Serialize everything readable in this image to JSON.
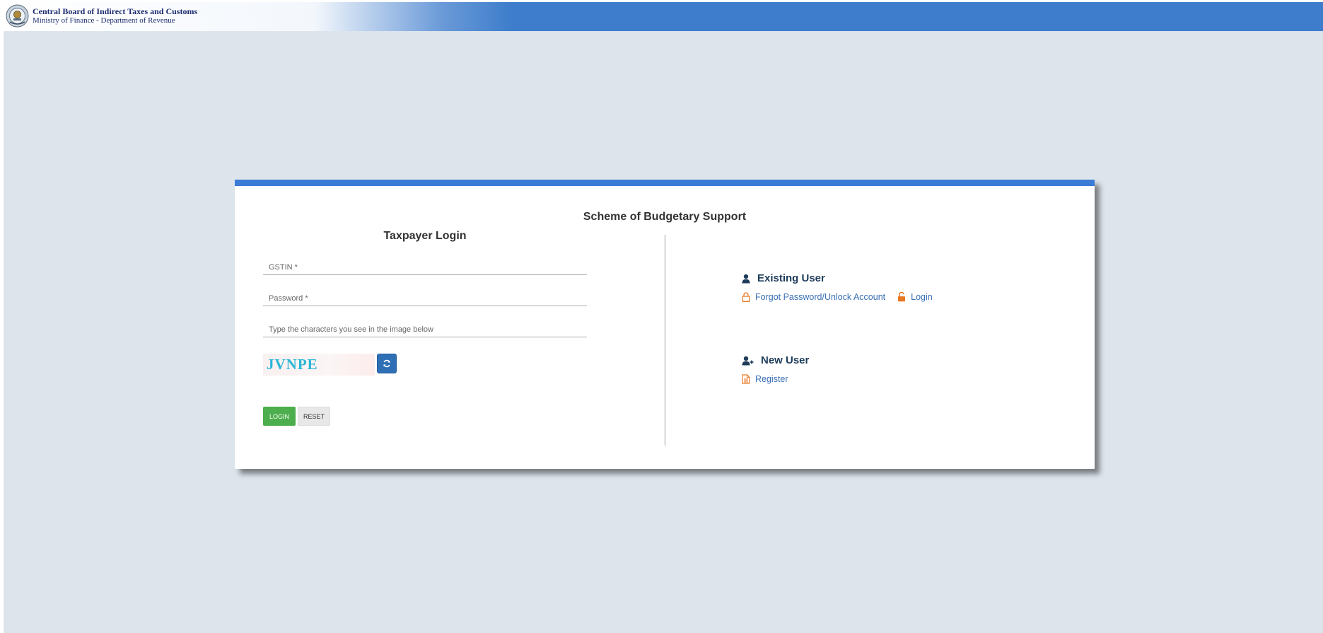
{
  "header": {
    "org_name": "Central Board of Indirect Taxes and Customs",
    "org_subtitle": "Ministry of Finance - Department of Revenue",
    "emblem_icon": "emblem-seal-icon",
    "gradient_color": "#3d7dcb"
  },
  "page": {
    "scheme_title": "Scheme of Budgetary Support",
    "accent_color": "#3a7bd5"
  },
  "login_form": {
    "title": "Taxpayer Login",
    "gstin_placeholder": "GSTIN *",
    "password_placeholder": "Password *",
    "captcha_placeholder": "Type the characters you see in the image below",
    "captcha_text": "JVNPE",
    "refresh_icon": "refresh-icon",
    "login_label": "LOGIN",
    "reset_label": "RESET",
    "login_color": "#4cae4c"
  },
  "existing_user": {
    "heading": "Existing User",
    "icon": "user-icon",
    "links": [
      {
        "label": "Forgot Password/Unlock Account",
        "icon": "lock-icon"
      },
      {
        "label": "Login",
        "icon": "unlock-icon"
      }
    ]
  },
  "new_user": {
    "heading": "New User",
    "icon": "user-plus-icon",
    "links": [
      {
        "label": "Register",
        "icon": "document-icon"
      }
    ]
  }
}
